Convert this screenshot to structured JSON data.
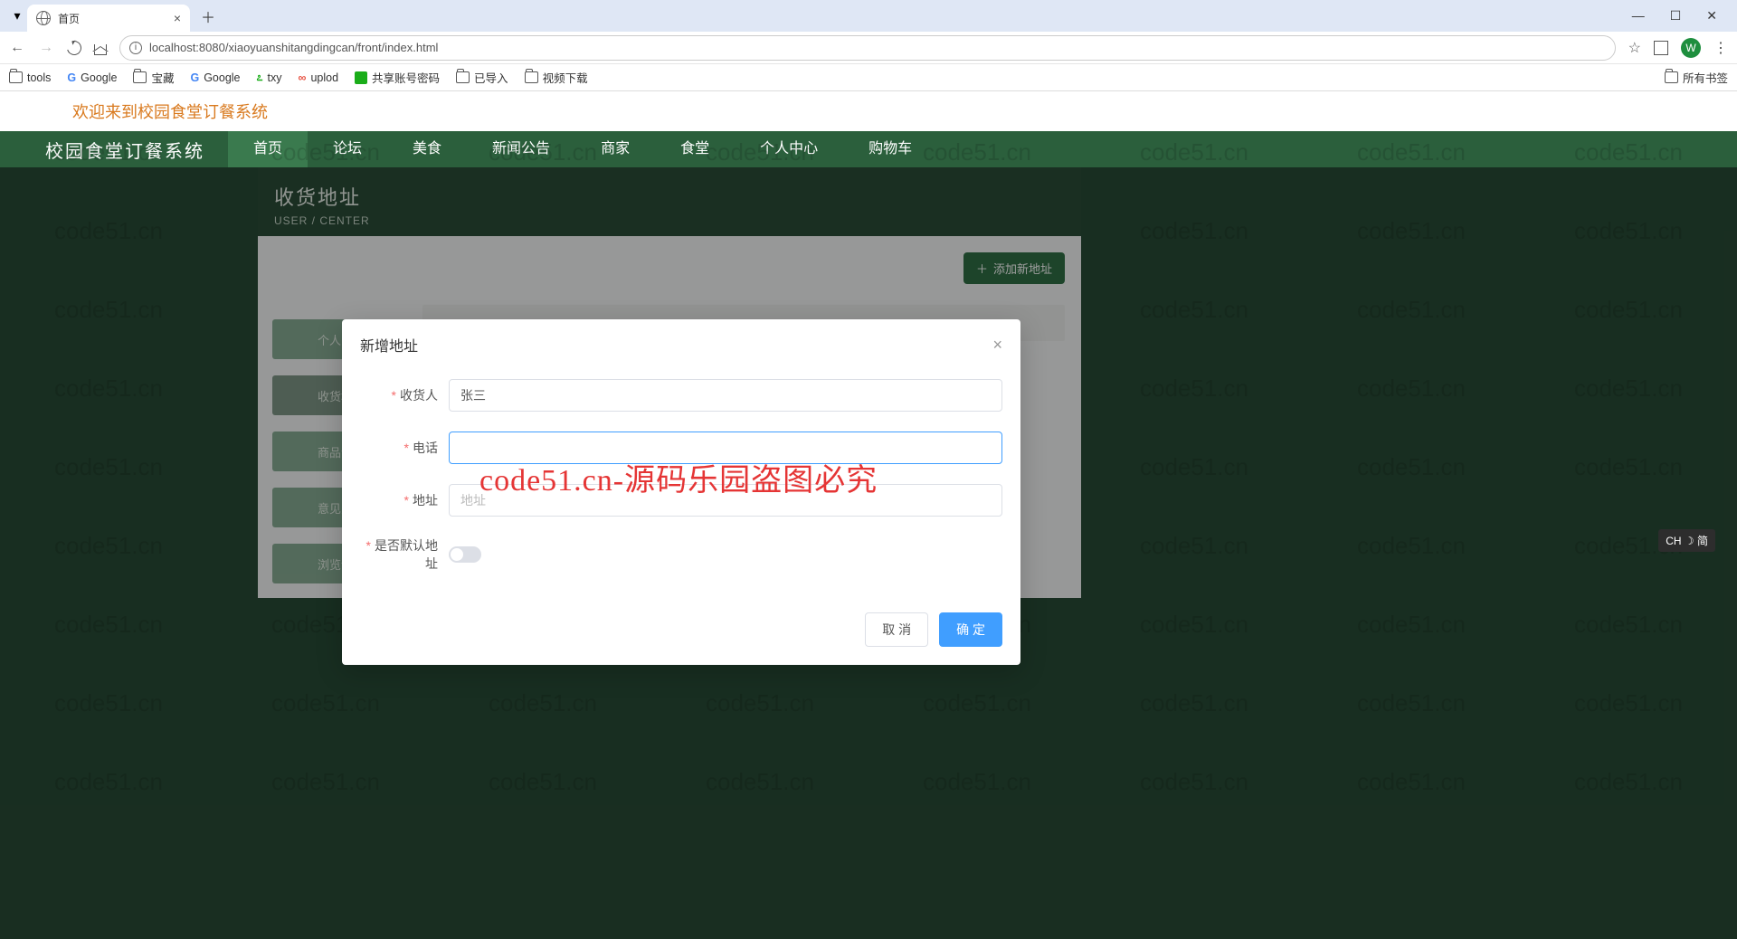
{
  "browser": {
    "tab_title": "首页",
    "url": "localhost:8080/xiaoyuanshitangdingcan/front/index.html",
    "avatar_letter": "W",
    "win": {
      "min": "—",
      "max": "☐",
      "close": "✕"
    }
  },
  "bookmarks": {
    "items": [
      "tools",
      "Google",
      "宝藏",
      "Google",
      "txy",
      "uplod",
      "共享账号密码",
      "已导入",
      "视频下载"
    ],
    "right": "所有书签"
  },
  "welcome": "欢迎来到校园食堂订餐系统",
  "nav": {
    "logo": "校园食堂订餐系统",
    "items": [
      "首页",
      "论坛",
      "美食",
      "新闻公告",
      "商家",
      "食堂",
      "个人中心",
      "购物车"
    ],
    "active_index": 0
  },
  "panel": {
    "title": "收货地址",
    "subtitle": "USER / CENTER",
    "add_btn": "添加新地址",
    "side": [
      "个人中心",
      "收货地址",
      "商品订单",
      "意见反馈",
      "浏览记录"
    ]
  },
  "modal": {
    "title": "新增地址",
    "fields": {
      "name_label": "收货人",
      "name_value": "张三",
      "phone_label": "电话",
      "phone_value": "",
      "addr_label": "地址",
      "addr_placeholder": "地址",
      "default_label": "是否默认地址"
    },
    "cancel": "取 消",
    "confirm": "确 定"
  },
  "watermark_text": "code51.cn",
  "red_watermark": "code51.cn-源码乐园盗图必究",
  "ime": "CH ☽ 简"
}
